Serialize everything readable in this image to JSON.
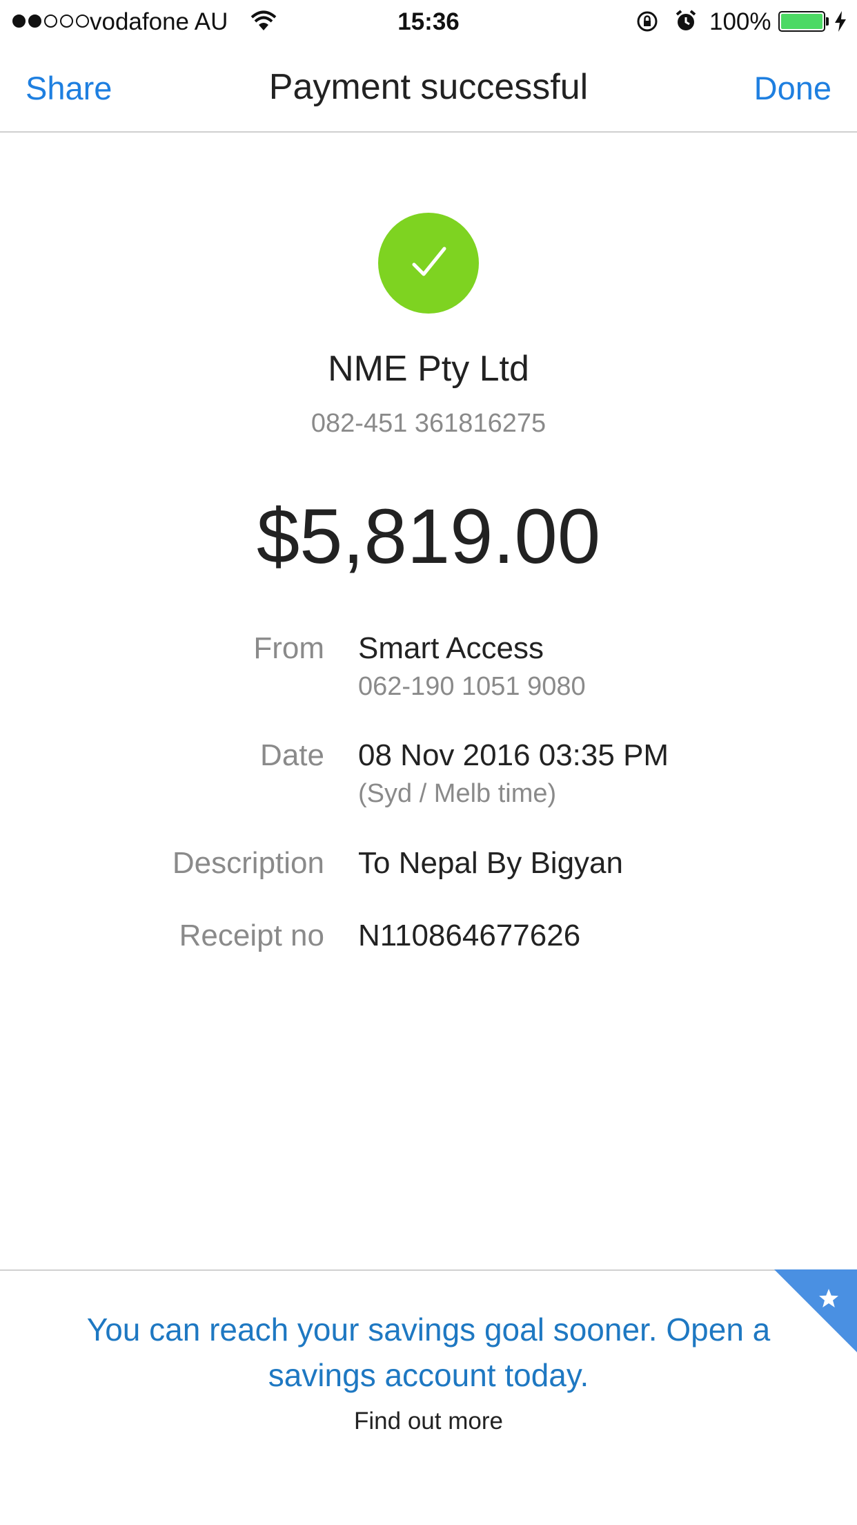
{
  "status_bar": {
    "signal_bars_filled": 2,
    "signal_bars_total": 5,
    "carrier": "vodafone AU",
    "time": "15:36",
    "battery_percent": "100%",
    "battery_level": 1.0,
    "battery_color": "#4cd964"
  },
  "nav": {
    "left_button": "Share",
    "title": "Payment successful",
    "right_button": "Done",
    "accent_color": "#1e7fe0"
  },
  "receipt": {
    "status_icon": "checkmark-icon",
    "status_color": "#7ed321",
    "payee_name": "NME Pty Ltd",
    "payee_account": "082-451 361816275",
    "amount": "$5,819.00",
    "details": {
      "from_label": "From",
      "from_value": "Smart Access",
      "from_sub": "062-190 1051 9080",
      "date_label": "Date",
      "date_value": "08 Nov 2016 03:35 PM",
      "date_sub": "(Syd / Melb time)",
      "description_label": "Description",
      "description_value": "To Nepal By Bigyan",
      "receipt_label": "Receipt no",
      "receipt_value": "N110864677626"
    }
  },
  "promo": {
    "icon": "star-icon",
    "ribbon_color": "#4a90e2",
    "text": "You can reach your savings goal sooner. Open a savings account today.",
    "link": "Find out more"
  }
}
